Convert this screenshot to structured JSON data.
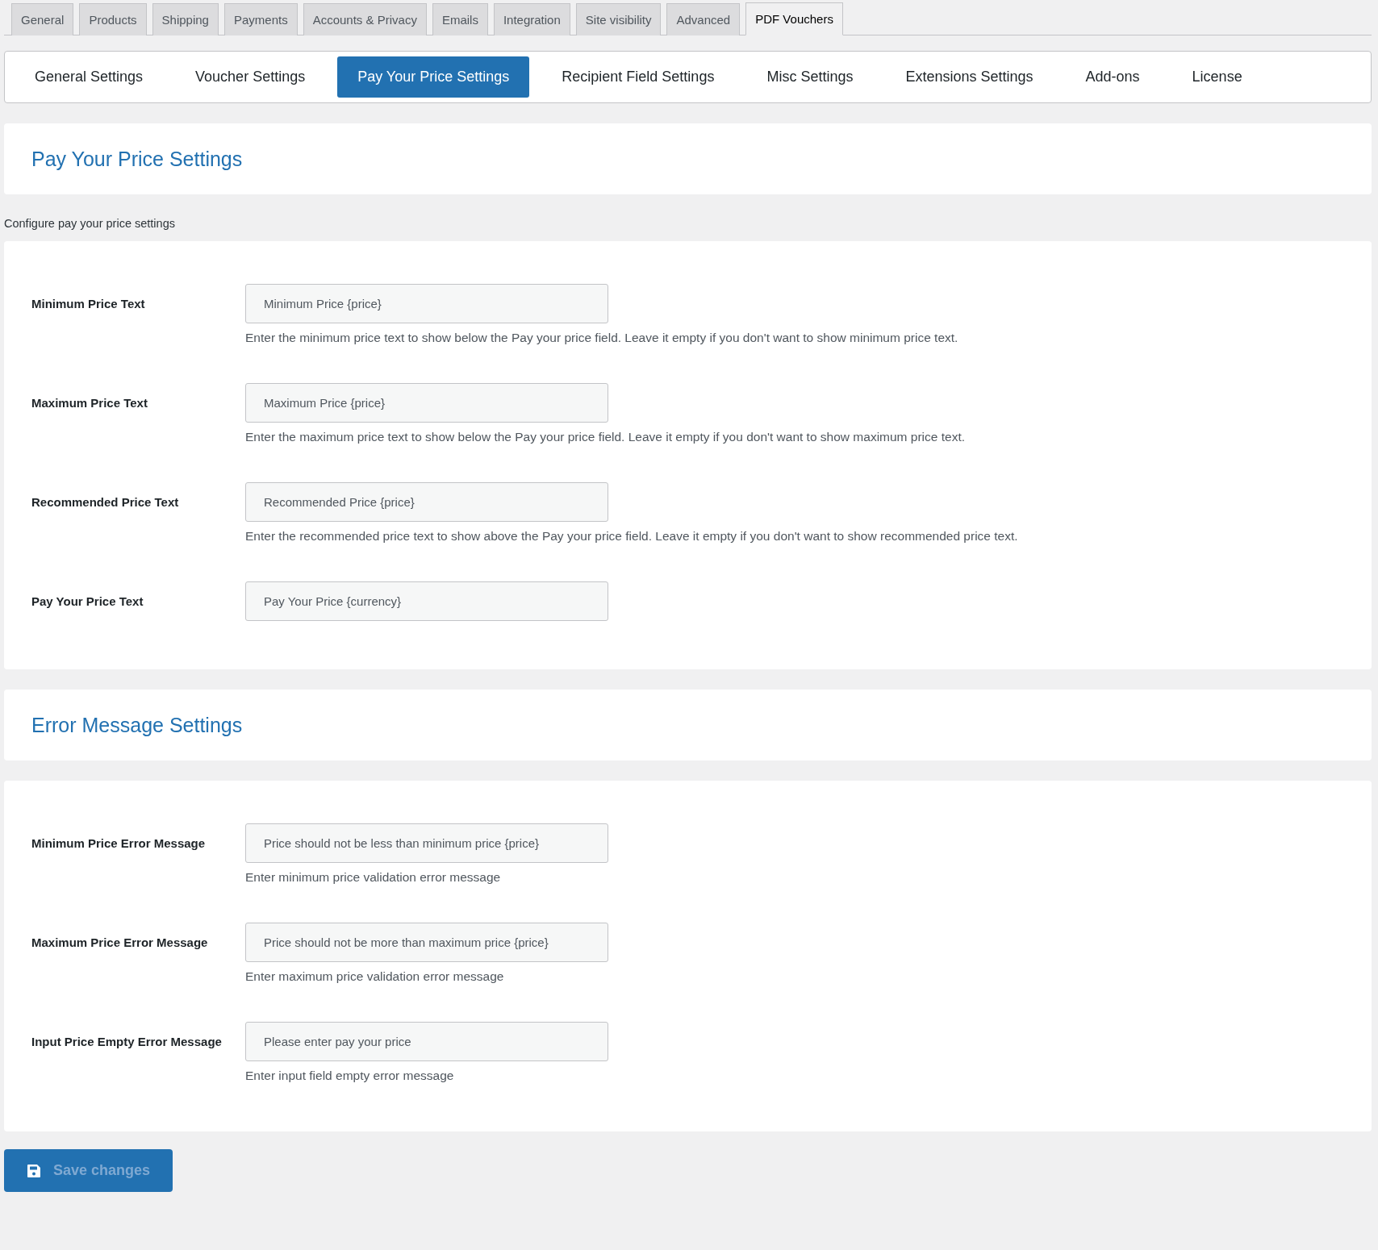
{
  "top_tabs": [
    {
      "label": "General",
      "selected": false
    },
    {
      "label": "Products",
      "selected": false
    },
    {
      "label": "Shipping",
      "selected": false
    },
    {
      "label": "Payments",
      "selected": false
    },
    {
      "label": "Accounts & Privacy",
      "selected": false
    },
    {
      "label": "Emails",
      "selected": false
    },
    {
      "label": "Integration",
      "selected": false
    },
    {
      "label": "Site visibility",
      "selected": false
    },
    {
      "label": "Advanced",
      "selected": false
    },
    {
      "label": "PDF Vouchers",
      "selected": true
    }
  ],
  "sub_tabs": [
    {
      "label": "General Settings",
      "selected": false
    },
    {
      "label": "Voucher Settings",
      "selected": false
    },
    {
      "label": "Pay Your Price Settings",
      "selected": true
    },
    {
      "label": "Recipient Field Settings",
      "selected": false
    },
    {
      "label": "Misc Settings",
      "selected": false
    },
    {
      "label": "Extensions Settings",
      "selected": false
    },
    {
      "label": "Add-ons",
      "selected": false
    },
    {
      "label": "License",
      "selected": false
    }
  ],
  "sections": [
    {
      "title": "Pay Your Price Settings",
      "description": "Configure pay your price settings",
      "fields": [
        {
          "label": "Minimum Price Text",
          "placeholder": "Minimum Price {price}",
          "help": "Enter the minimum price text to show below the Pay your price field. Leave it empty if you don't want to show minimum price text."
        },
        {
          "label": "Maximum Price Text",
          "placeholder": "Maximum Price {price}",
          "help": "Enter the maximum price text to show below the Pay your price field. Leave it empty if you don't want to show maximum price text."
        },
        {
          "label": "Recommended Price Text",
          "placeholder": "Recommended Price {price}",
          "help": "Enter the recommended price text to show above the Pay your price field. Leave it empty if you don't want to show recommended price text."
        },
        {
          "label": "Pay Your Price Text",
          "placeholder": "Pay Your Price {currency}"
        }
      ]
    },
    {
      "title": "Error Message Settings",
      "fields": [
        {
          "label": "Minimum Price Error Message",
          "placeholder": "Price should not be less than minimum price {price}",
          "help": "Enter minimum price validation error message"
        },
        {
          "label": "Maximum Price Error Message",
          "placeholder": "Price should not be more than maximum price {price}",
          "help": "Enter maximum price validation error message"
        },
        {
          "label": "Input Price Empty Error Message",
          "placeholder": "Please enter pay your price",
          "help": "Enter input field empty error message"
        }
      ]
    }
  ],
  "save_button": {
    "label": "Save changes",
    "disabled": true
  }
}
